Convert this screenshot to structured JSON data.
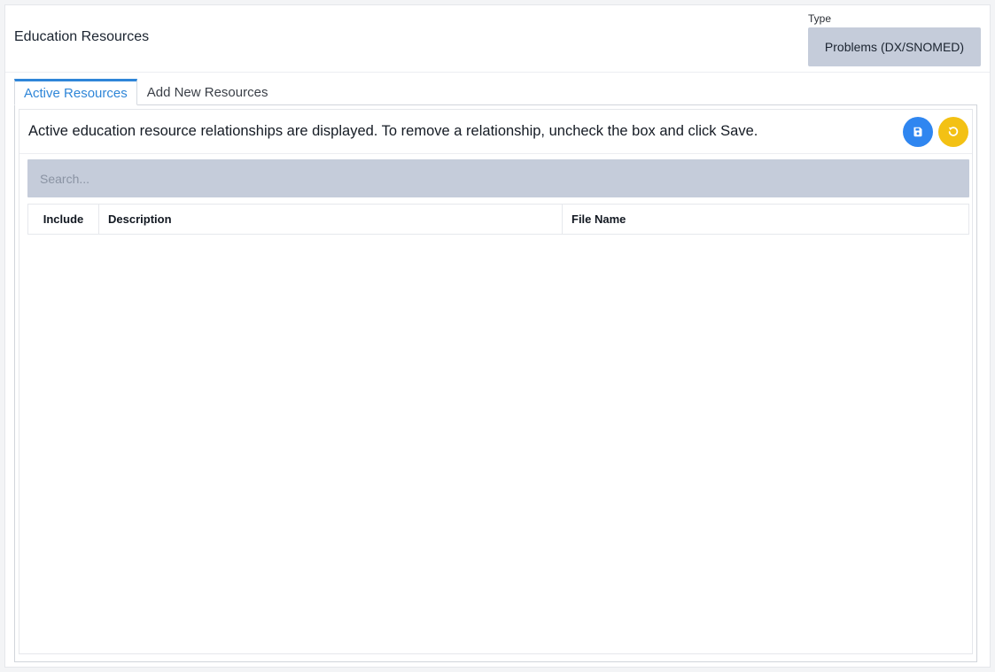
{
  "header": {
    "title": "Education Resources",
    "type_label": "Type",
    "type_value": "Problems (DX/SNOMED)"
  },
  "tabs": [
    {
      "label": "Active Resources",
      "active": true
    },
    {
      "label": "Add New Resources",
      "active": false
    }
  ],
  "active_tab": {
    "info_text": "Active education resource relationships are displayed. To remove a relationship, uncheck the box and click Save.",
    "save_icon": "floppy-disk-icon",
    "reset_icon": "undo-icon",
    "search_placeholder": "Search...",
    "table": {
      "columns": [
        "Include",
        "Description",
        "File Name"
      ],
      "rows": []
    }
  },
  "colors": {
    "accent": "#2f86d8",
    "save_button": "#2f86f0",
    "reset_button": "#f3c114",
    "input_bg": "#c5ccda"
  }
}
